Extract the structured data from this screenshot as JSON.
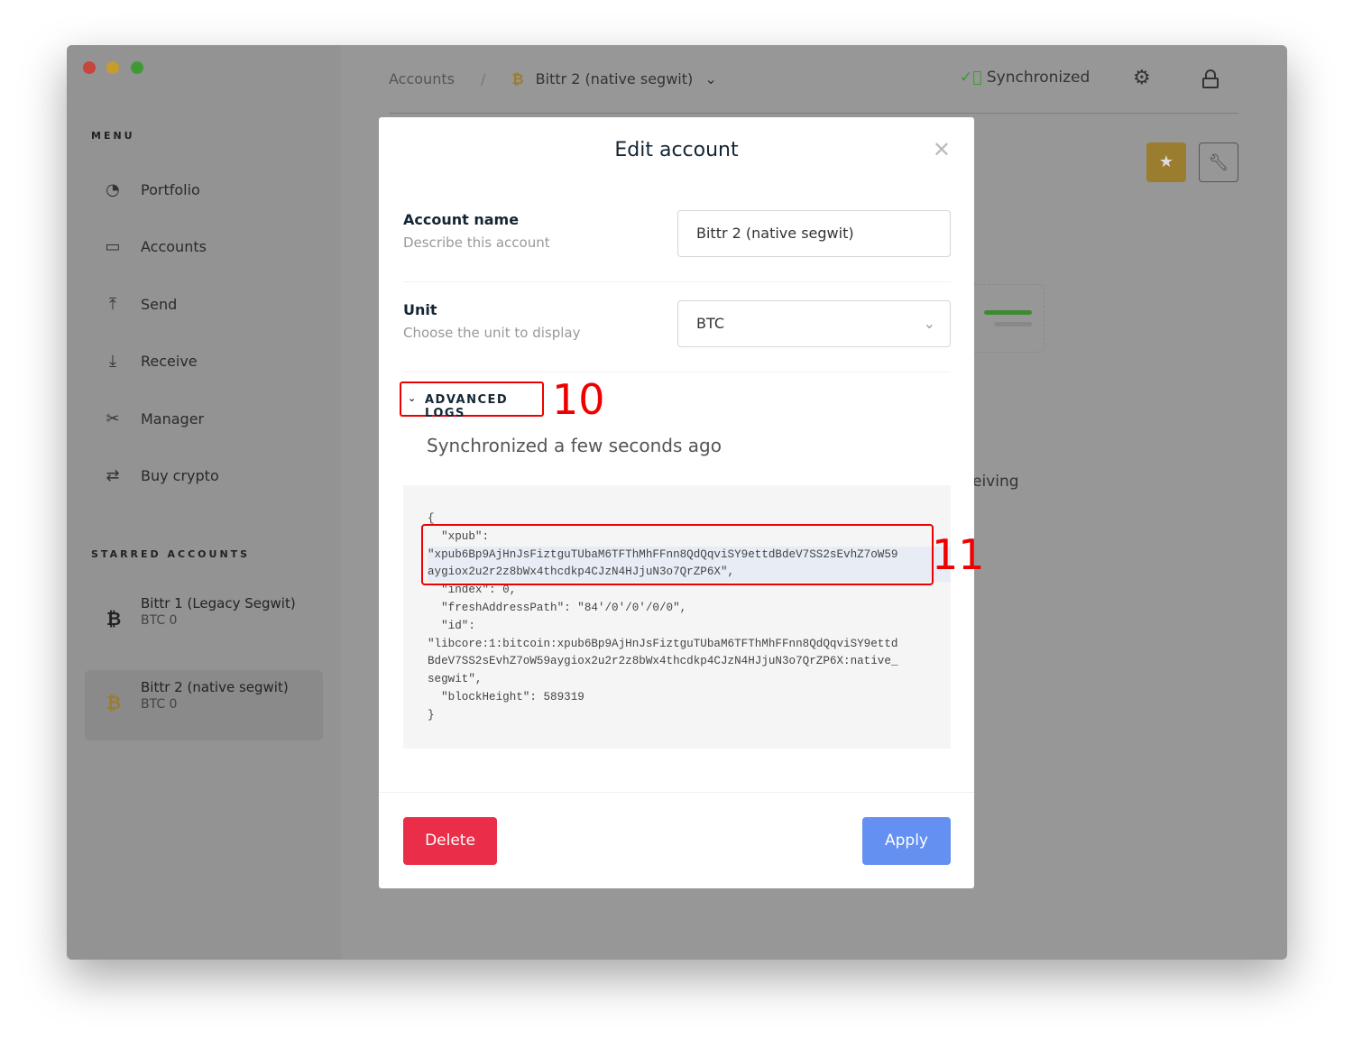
{
  "window": {
    "controls": [
      "close",
      "minimize",
      "zoom"
    ]
  },
  "sidebar": {
    "menu_title": "MENU",
    "items": [
      {
        "label": "Portfolio",
        "icon": "pie-chart-icon"
      },
      {
        "label": "Accounts",
        "icon": "wallet-icon"
      },
      {
        "label": "Send",
        "icon": "upload-icon"
      },
      {
        "label": "Receive",
        "icon": "download-icon"
      },
      {
        "label": "Manager",
        "icon": "tools-icon"
      },
      {
        "label": "Buy crypto",
        "icon": "exchange-icon"
      }
    ],
    "starred_title": "STARRED ACCOUNTS",
    "starred": [
      {
        "name": "Bittr 1 (Legacy Segwit)",
        "balance": "BTC 0"
      },
      {
        "name": "Bittr 2 (native segwit)",
        "balance": "BTC 0"
      }
    ]
  },
  "topbar": {
    "breadcrumb_root": "Accounts",
    "breadcrumb_sep": "/",
    "breadcrumb_current": "Bittr 2 (native segwit)",
    "sync_status": "Synchronized"
  },
  "background": {
    "partial_text": "eiving"
  },
  "modal": {
    "title": "Edit account",
    "account_name_label": "Account name",
    "account_name_desc": "Describe this account",
    "account_name_value": "Bittr 2 (native segwit)",
    "unit_label": "Unit",
    "unit_desc": "Choose the unit to display",
    "unit_value": "BTC",
    "advanced_logs": "ADVANCED LOGS",
    "sync_text": "Synchronized a few seconds ago",
    "logs": [
      "{",
      "  \"xpub\":",
      "\"xpub6Bp9AjHnJsFiztguTUbaM6TFThMhFFnn8QdQqviSY9ettdBdeV7SS2sEvhZ7oW59",
      "aygiox2u2r2z8bWx4thcdkp4CJzN4HJjuN3o7QrZP6X\",",
      "  \"index\": 0,",
      "  \"freshAddressPath\": \"84'/0'/0'/0/0\",",
      "  \"id\":",
      "\"libcore:1:bitcoin:xpub6Bp9AjHnJsFiztguTUbaM6TFThMhFFnn8QdQqviSY9ettd",
      "BdeV7SS2sEvhZ7oW59aygiox2u2r2z8bWx4thcdkp4CJzN4HJjuN3o7QrZP6X:native_",
      "segwit\",",
      "  \"blockHeight\": 589319",
      "}"
    ],
    "delete_label": "Delete",
    "apply_label": "Apply"
  },
  "annotations": [
    "10",
    "11"
  ],
  "colors": {
    "delete": "#ea2e49",
    "apply": "#6490f1",
    "sync": "#3a9a2f",
    "star": "#9a7d2e",
    "annotation": "#ee0000"
  }
}
